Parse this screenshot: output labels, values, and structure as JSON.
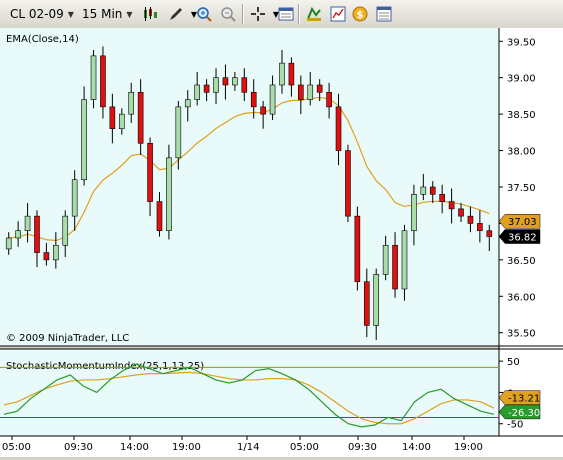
{
  "toolbar": {
    "instrument": "CL 02-09",
    "interval": "15 Min",
    "icons": [
      "candlestick-icon",
      "pencil-icon",
      "zoom-in-icon",
      "zoom-out-icon",
      "crosshair-icon",
      "properties-icon",
      "instrument-icon",
      "indicator-icon",
      "strategy-icon",
      "data-box-icon"
    ]
  },
  "colors": {
    "background": "#e8fafa",
    "up": "#a8dca8",
    "down": "#e01010",
    "ema": "#e0a020",
    "smi": "#2a9a2a",
    "signal": "#e0a020"
  },
  "price_panel": {
    "indicator_label": "EMA(Close,14)",
    "copyright": "© 2009 NinjaTrader, LLC",
    "y_ticks": [
      "39.50",
      "39.00",
      "38.50",
      "38.00",
      "37.50",
      "37.00",
      "36.50",
      "36.00",
      "35.50"
    ],
    "ema_badge": "37.03",
    "price_badge": "36.82"
  },
  "smi_panel": {
    "label": "StochasticMomentumIndex(25,1,13,25)",
    "y_ticks": [
      "50",
      "0",
      "-50"
    ],
    "smi_badge": "-13.21",
    "signal_badge": "-26.30"
  },
  "x_axis": {
    "labels": [
      "05:00",
      "09:30",
      "14:00",
      "19:00",
      "1/14",
      "05:00",
      "09:30",
      "14:00",
      "19:00"
    ]
  },
  "chart_data": {
    "type": "candlestick",
    "instrument": "CL 02-09",
    "interval": "15 Min",
    "ylim": [
      35.4,
      39.6
    ],
    "closes": [
      36.8,
      36.9,
      37.1,
      36.6,
      36.5,
      36.7,
      37.1,
      37.6,
      38.7,
      39.3,
      38.6,
      38.3,
      38.5,
      38.8,
      38.1,
      37.3,
      36.9,
      37.9,
      38.6,
      38.7,
      38.9,
      38.8,
      39.0,
      38.9,
      39.0,
      38.8,
      38.6,
      38.5,
      38.9,
      39.2,
      38.9,
      38.7,
      38.9,
      38.8,
      38.6,
      38.0,
      37.1,
      36.2,
      35.6,
      36.3,
      36.7,
      36.1,
      36.9,
      37.4,
      37.5,
      37.4,
      37.3,
      37.2,
      37.1,
      37.0,
      36.9,
      36.82
    ],
    "ema_label": "EMA(Close,14)",
    "ema_last": 37.03,
    "last_price": 36.82,
    "smi": {
      "name": "StochasticMomentumIndex(25,1,13,25)",
      "ylim": [
        -60,
        55
      ],
      "smi_values": [
        -35,
        -30,
        -10,
        5,
        20,
        28,
        10,
        0,
        20,
        35,
        45,
        38,
        30,
        35,
        40,
        30,
        20,
        15,
        20,
        35,
        38,
        30,
        20,
        5,
        -15,
        -35,
        -50,
        -55,
        -52,
        -40,
        -45,
        -15,
        0,
        5,
        -10,
        -20,
        -30,
        -35
      ],
      "signal_values": [
        -20,
        -15,
        -5,
        5,
        12,
        18,
        20,
        20,
        22,
        25,
        28,
        30,
        30,
        31,
        32,
        30,
        26,
        22,
        20,
        20,
        22,
        22,
        20,
        12,
        0,
        -15,
        -30,
        -42,
        -48,
        -50,
        -50,
        -42,
        -30,
        -18,
        -12,
        -12,
        -15,
        -25
      ],
      "smi_last": -13.21,
      "signal_last": -26.3
    }
  }
}
